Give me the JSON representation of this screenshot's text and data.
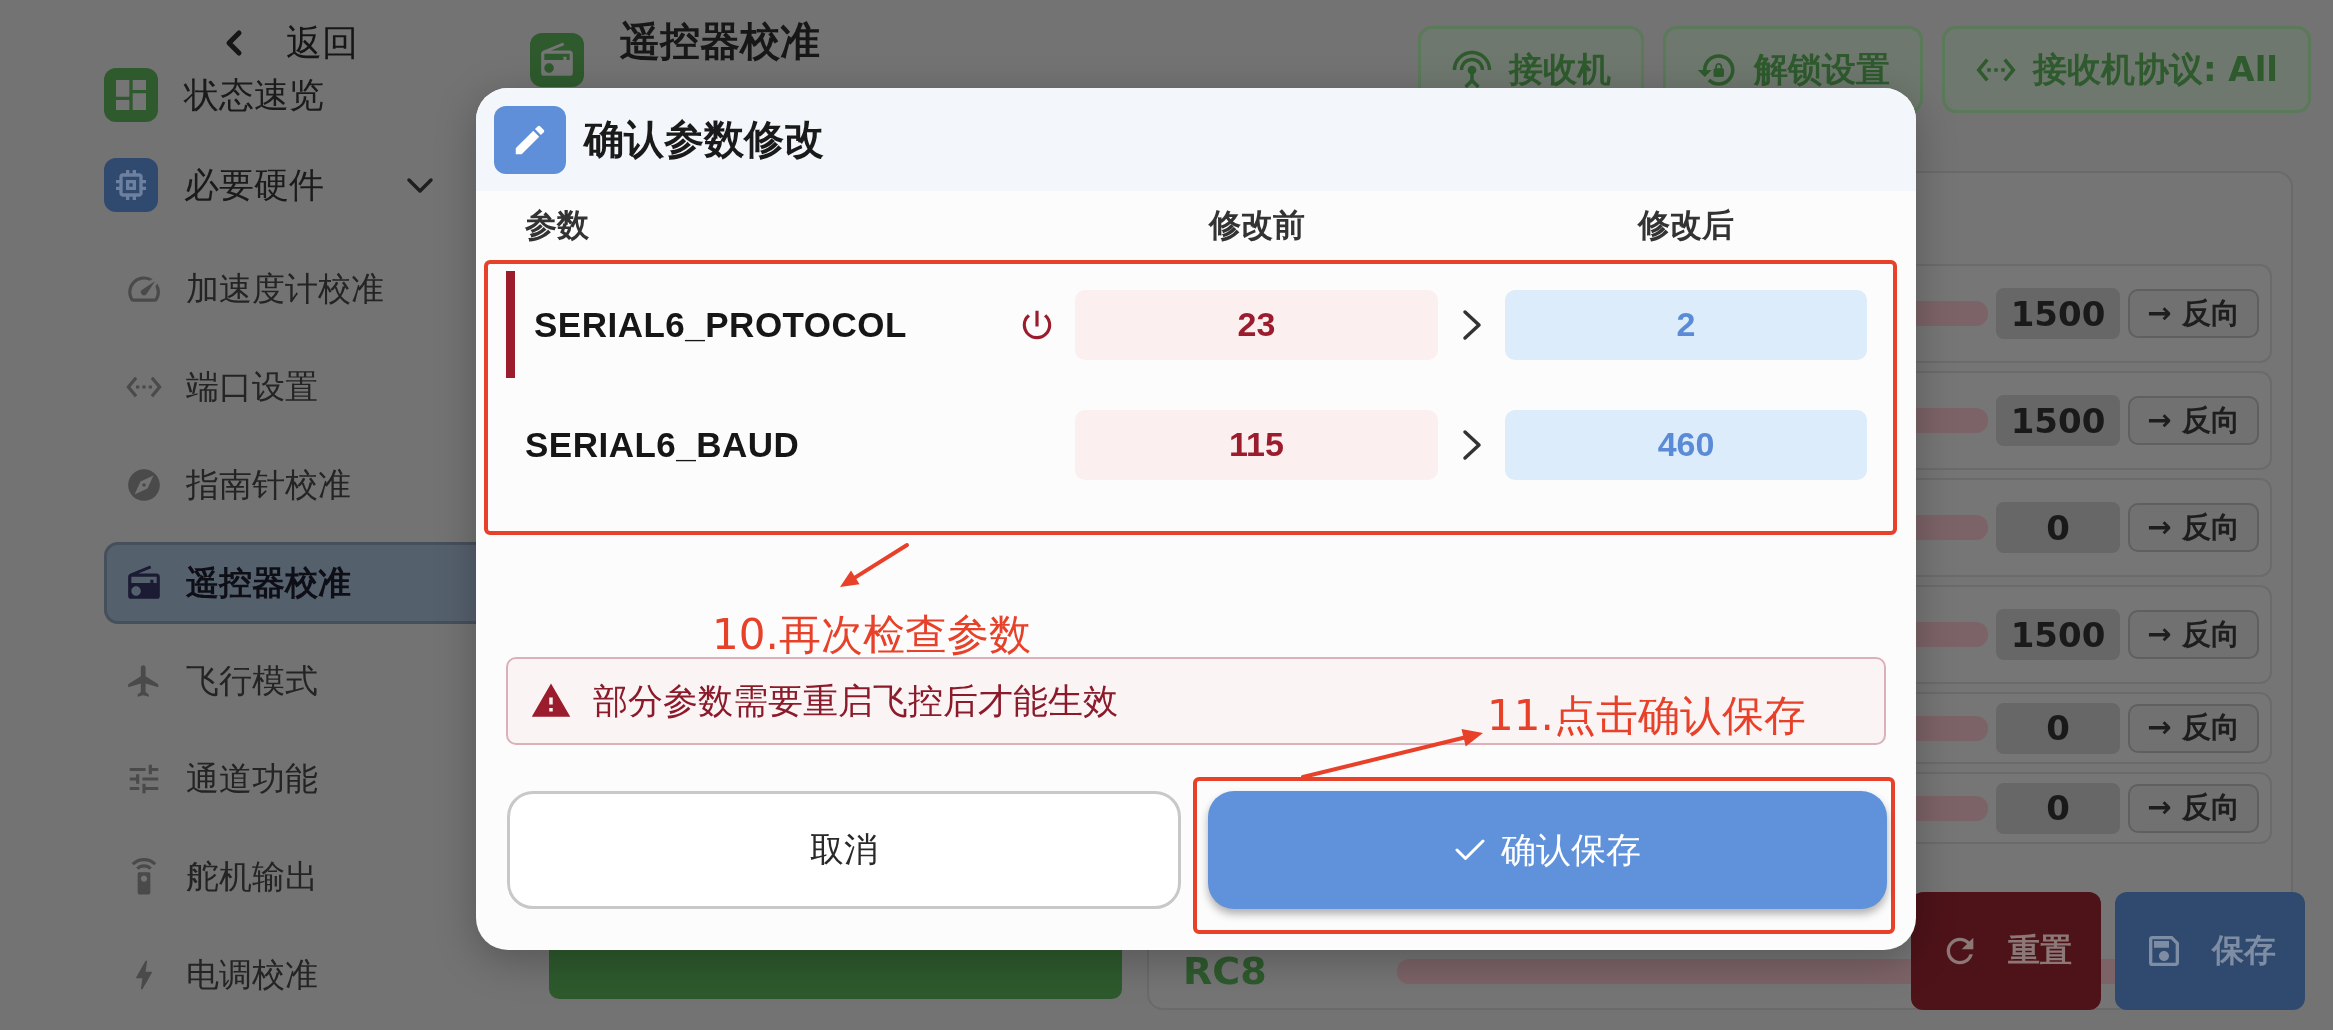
{
  "sidebar": {
    "back": "返回",
    "items": [
      {
        "label": "状态速览",
        "selected": false
      },
      {
        "label": "必要硬件",
        "selected": false,
        "expanded": true,
        "children": [
          {
            "label": "加速度计校准",
            "selected": false
          },
          {
            "label": "端口设置",
            "selected": false
          },
          {
            "label": "指南针校准",
            "selected": false
          },
          {
            "label": "遥控器校准",
            "selected": true
          },
          {
            "label": "飞行模式",
            "selected": false
          },
          {
            "label": "通道功能",
            "selected": false
          },
          {
            "label": "舵机输出",
            "selected": false
          },
          {
            "label": "电调校准",
            "selected": false
          }
        ]
      }
    ]
  },
  "header": {
    "title": "遥控器校准",
    "buttons": [
      {
        "label": "接收机"
      },
      {
        "label": "解锁设置"
      },
      {
        "label": "接收机协议: All"
      }
    ]
  },
  "channels": [
    {
      "kind": "value",
      "value": "1500",
      "button": "→ 反向"
    },
    {
      "kind": "value",
      "value": "1500",
      "button": "→ 反向"
    },
    {
      "kind": "value",
      "value": "0",
      "button": "→ 反向"
    },
    {
      "kind": "value",
      "value": "1500",
      "button": "→ 反向"
    },
    {
      "kind": "value",
      "value": "0",
      "button": "→ 反向"
    },
    {
      "kind": "value",
      "value": "0",
      "button": "→ 反向"
    },
    {
      "kind": "label",
      "label": "RC8"
    }
  ],
  "actions": [
    {
      "kind": "reset",
      "label": "重置"
    },
    {
      "kind": "save",
      "label": "保存"
    }
  ],
  "dialog": {
    "title": "确认参数修改",
    "columns": [
      "参数",
      "修改前",
      "修改后"
    ],
    "rows": [
      {
        "name": "SERIAL6_PROTOCOL",
        "reboot_required": true,
        "before": "23",
        "after": "2"
      },
      {
        "name": "SERIAL6_BAUD",
        "reboot_required": false,
        "before": "115",
        "after": "460"
      }
    ],
    "warning": "部分参数需要重启飞控后才能生效",
    "buttons": [
      {
        "kind": "cancel",
        "label": "取消"
      },
      {
        "kind": "confirm",
        "label": "确认保存"
      }
    ]
  },
  "annotations": [
    {
      "text": "10.再次检查参数"
    },
    {
      "text": "11.点击确认保存"
    }
  ]
}
